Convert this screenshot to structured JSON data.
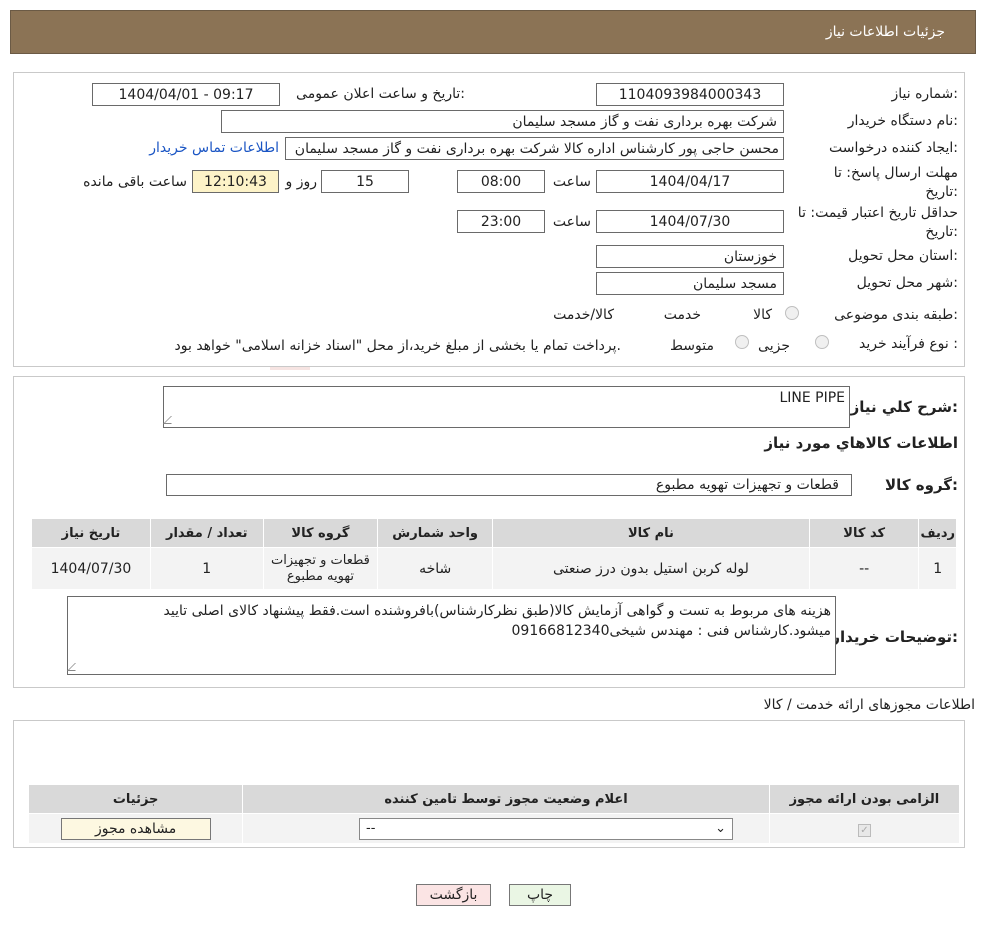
{
  "header": {
    "title": "جزئیات اطلاعات نیاز"
  },
  "form": {
    "need_number_label": "شماره نیاز:",
    "need_number": "1104093984000343",
    "announce_label": "تاریخ و ساعت اعلان عمومی:",
    "announce_value": "1404/04/01 - 09:17",
    "buyer_org_label": "نام دستگاه خریدار:",
    "buyer_org": "شرکت بهره برداری نفت و گاز مسجد سلیمان",
    "requester_label": "ایجاد کننده درخواست:",
    "requester": "محسن حاجی پور کارشناس اداره کالا  شرکت بهره برداری نفت و گاز مسجد سلیمان",
    "contact_link": "اطلاعات تماس خریدار",
    "deadline_label_1": "مهلت ارسال پاسخ: تا",
    "deadline_label_2": "تاریخ:",
    "deadline_date": "1404/04/17",
    "time_label": "ساعت",
    "deadline_time": "08:00",
    "days_value": "15",
    "days_label": "روز و",
    "remaining_time": "12:10:43",
    "remaining_label": "ساعت باقی مانده",
    "validity_label_1": "حداقل تاریخ اعتبار قیمت: تا",
    "validity_label_2": "تاریخ:",
    "validity_date": "1404/07/30",
    "validity_time": "23:00",
    "province_label": "استان محل تحویل:",
    "province": "خوزستان",
    "city_label": "شهر محل تحویل:",
    "city": "مسجد سلیمان",
    "category_label": "طبقه بندی موضوعی:",
    "category_options": [
      "کالا",
      "خدمت",
      "کالا/خدمت"
    ],
    "process_label": "نوع فرآیند خرید :",
    "process_options": [
      "جزیی",
      "متوسط"
    ],
    "process_note": "پرداخت تمام یا بخشی از مبلغ خرید،از محل \"اسناد خزانه اسلامی\" خواهد بود."
  },
  "summary": {
    "general_desc_label": "شرح کلي نياز:",
    "general_desc": "LINE PIPE",
    "goods_info_title": "اطلاعات کالاهاي مورد نياز",
    "goods_group_label": "گروه کالا:",
    "goods_group": "قطعات و تجهیزات تهویه مطبوع",
    "table_headers": [
      "ردیف",
      "کد کالا",
      "نام کالا",
      "واحد شمارش",
      "گروه کالا",
      "تعداد / مقدار",
      "تاریخ نیاز"
    ],
    "rows": [
      {
        "row": "1",
        "code": "--",
        "name": "لوله کربن استیل بدون درز صنعتی",
        "unit": "شاخه",
        "group": "قطعات و تجهیزات تهویه مطبوع",
        "qty": "1",
        "date": "1404/07/30"
      }
    ],
    "buyer_notes_label": "توضیحات خریدار:",
    "buyer_notes": "هزینه های مربوط به تست و گواهی آزمایش کالا(طبق نظرکارشناس)بافروشنده است.فقط پیشنهاد کالای اصلی تایید میشود.کارشناس فنی : مهندس شیخی09166812340"
  },
  "permits": {
    "title": "اطلاعات مجوزهای ارائه خدمت / کالا",
    "headers": [
      "الزامی بودن ارائه مجوز",
      "اعلام وضعیت مجوز توسط تامین کننده",
      "جزئیات"
    ],
    "select_value": "--",
    "view_button": "مشاهده مجوز"
  },
  "footer": {
    "print_button": "چاپ",
    "back_button": "بازگشت"
  },
  "watermark": "AriaTender.neT"
}
